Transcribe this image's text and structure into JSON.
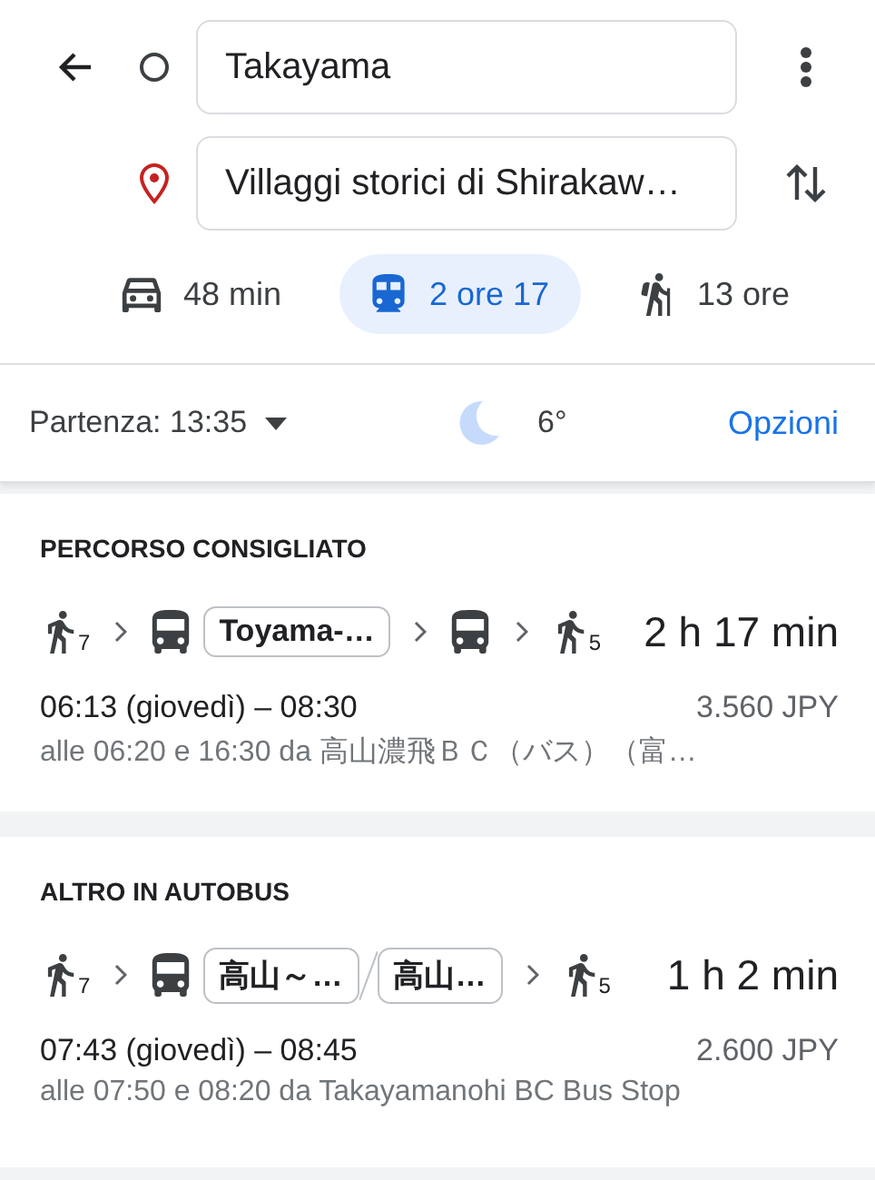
{
  "search": {
    "origin": "Takayama",
    "destination": "Villaggi storici di Shirakaw…"
  },
  "modes": [
    {
      "kind": "car",
      "label": "48 min",
      "selected": false
    },
    {
      "kind": "transit",
      "label": "2 ore 17",
      "selected": true
    },
    {
      "kind": "hike",
      "label": "13 ore",
      "selected": false
    }
  ],
  "departure": {
    "label": "Partenza: 13:35",
    "temperature": "6°",
    "options": "Opzioni"
  },
  "routes": [
    {
      "heading": "PERCORSO CONSIGLIATO",
      "steps": [
        {
          "kind": "walk",
          "minutes": "7"
        },
        {
          "kind": "bus",
          "labels": [
            "Toyama-…"
          ]
        },
        {
          "kind": "bus"
        },
        {
          "kind": "walk",
          "minutes": "5"
        }
      ],
      "duration": "2 h 17 min",
      "times": "06:13 (giovedì) – 08:30",
      "price": "3.560 JPY",
      "detail": "alle 06:20 e 16:30 da 高山濃飛ＢＣ（バス）（富…"
    },
    {
      "heading": "ALTRO IN AUTOBUS",
      "steps": [
        {
          "kind": "walk",
          "minutes": "7"
        },
        {
          "kind": "bus",
          "labels": [
            "高山～…",
            "高山…"
          ]
        },
        {
          "kind": "walk",
          "minutes": "5"
        }
      ],
      "duration": "1 h 2 min",
      "times": "07:43 (giovedì) – 08:45",
      "price": "2.600 JPY",
      "detail": "alle 07:50 e 08:20 da Takayamanohi BC Bus Stop"
    }
  ]
}
